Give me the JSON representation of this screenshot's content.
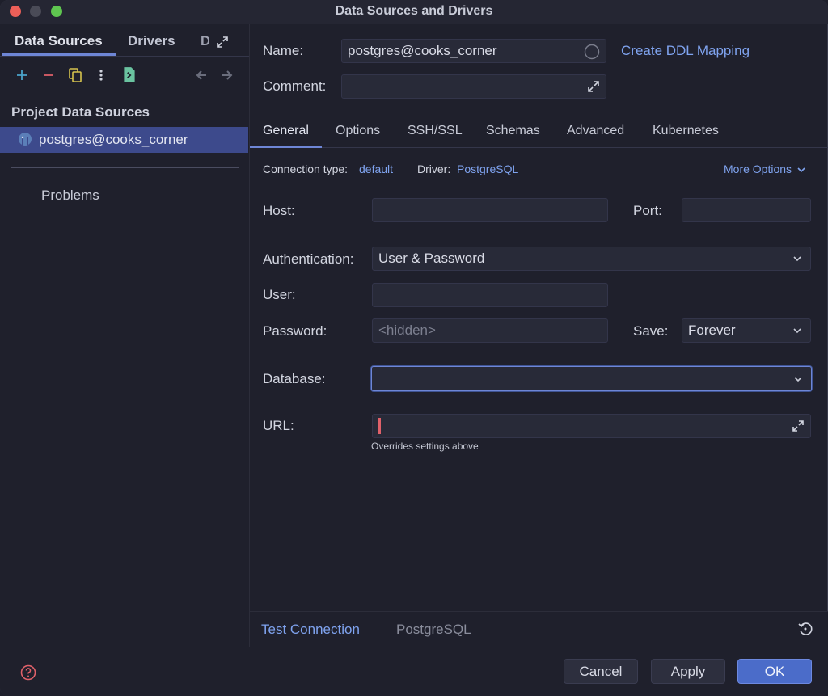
{
  "window": {
    "title": "Data Sources and Drivers"
  },
  "sidebar": {
    "tabs": [
      "Data Sources",
      "Drivers",
      "D"
    ],
    "section_title": "Project Data Sources",
    "data_source": "postgres@cooks_corner",
    "problems": "Problems"
  },
  "form": {
    "name_label": "Name:",
    "name_value": "postgres@cooks_corner",
    "ddl_link": "Create DDL Mapping",
    "comment_label": "Comment:",
    "comment_value": ""
  },
  "tabs": [
    "General",
    "Options",
    "SSH/SSL",
    "Schemas",
    "Advanced",
    "Kubernetes"
  ],
  "general": {
    "conn_type_label": "Connection type:",
    "conn_type_value": "default",
    "driver_label": "Driver:",
    "driver_value": "PostgreSQL",
    "more_options": "More Options",
    "host_label": "Host:",
    "host_value": "",
    "port_label": "Port:",
    "port_value": "",
    "auth_label": "Authentication:",
    "auth_value": "User & Password",
    "user_label": "User:",
    "user_value": "",
    "password_label": "Password:",
    "password_placeholder": "<hidden>",
    "save_label": "Save:",
    "save_value": "Forever",
    "database_label": "Database:",
    "database_value": "",
    "url_label": "URL:",
    "url_value": "",
    "url_hint": "Overrides settings above"
  },
  "bottom": {
    "test_connection": "Test Connection",
    "driver_name": "PostgreSQL"
  },
  "footer": {
    "cancel": "Cancel",
    "apply": "Apply",
    "ok": "OK"
  },
  "colors": {
    "accent": "#6e86d6",
    "link": "#7fa3ef",
    "selection": "#3d4a8c",
    "error": "#e0616a"
  }
}
